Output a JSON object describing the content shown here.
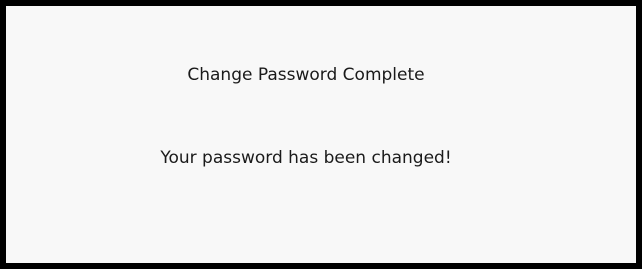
{
  "dialog": {
    "title": "Change Password Complete",
    "message": "Your password has been changed!"
  },
  "colors": {
    "border": "#000000",
    "background": "#f8f8f8",
    "text": "#1a1a1a"
  }
}
